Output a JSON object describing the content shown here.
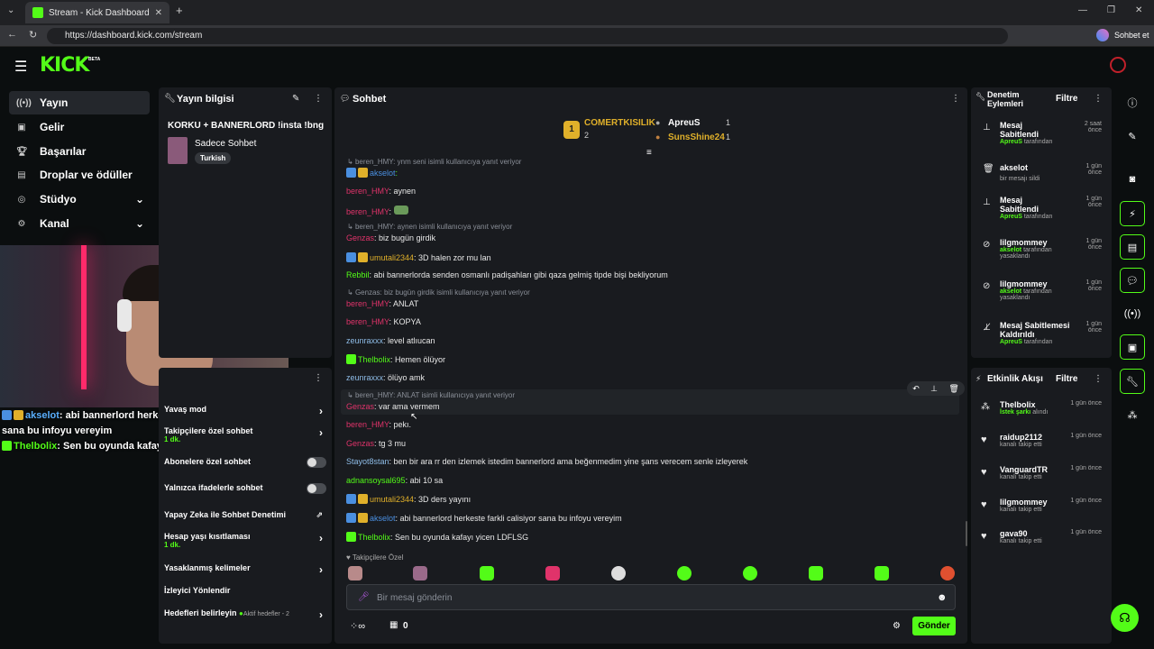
{
  "browser": {
    "tab_title": "Stream - Kick Dashboard",
    "url": "https://dashboard.kick.com/stream",
    "copilot_label": "Sohbet et"
  },
  "app": {
    "logo": "KICK",
    "beta": "BETA"
  },
  "sidebar": {
    "items": [
      {
        "label": "Yayın",
        "icon": "broadcast-icon"
      },
      {
        "label": "Gelir",
        "icon": "revenue-icon"
      },
      {
        "label": "Başarılar",
        "icon": "trophy-icon"
      },
      {
        "label": "Droplar ve ödüller",
        "icon": "gift-icon"
      },
      {
        "label": "Stüdyo",
        "icon": "studio-icon"
      },
      {
        "label": "Kanal",
        "icon": "channel-icon"
      }
    ]
  },
  "stream_info": {
    "header": "Yayın bilgisi",
    "title": "KORKU + BANNERLORD !insta !bng",
    "category": "Sadece Sohbet",
    "tag": "Turkish"
  },
  "overlay_chat": [
    {
      "user": "akselot",
      "text": ": abi bannerlord herkeste farkli calisiyor sana bu infoyu vereyim"
    },
    {
      "user": "Thelbolix",
      "text": ": Sen bu oyunda kafayı yicen LDFLSG"
    }
  ],
  "settings": {
    "rows": [
      {
        "label": "Yavaş mod"
      },
      {
        "label": "Takipçilere özel sohbet",
        "sub": "1 dk."
      },
      {
        "label": "Abonelere özel sohbet"
      },
      {
        "label": "Yalnızca ifadelerle sohbet"
      },
      {
        "label": "Yapay Zeka ile Sohbet Denetimi"
      },
      {
        "label": "Hesap yaşı kısıtlaması",
        "sub": "1 dk."
      },
      {
        "label": "Yasaklanmış kelimeler"
      },
      {
        "label": "İzleyici Yönlendir"
      },
      {
        "label": "Hedefleri belirleyin",
        "sub": "Aktif hedefler - 2"
      }
    ]
  },
  "chat": {
    "header": "Sohbet",
    "top_gifter": {
      "rank": "1",
      "name": "COMERTKISILIK",
      "count": "2"
    },
    "gifters": [
      {
        "name": "ApreuS",
        "count": "1"
      },
      {
        "name": "SunsShine24",
        "count": "1"
      }
    ],
    "messages": [
      {
        "reply": "beren_HMY: ynm seni isimli kullanıcıya yanıt veriyor",
        "user": "akselot",
        "text": "",
        "color": "#4a8fe0"
      },
      {
        "reply": "",
        "user": "beren_HMY",
        "text": ": aynen",
        "color": "#e0336a"
      },
      {
        "reply": "",
        "user": "beren_HMY",
        "text": ":",
        "color": "#e0336a"
      },
      {
        "reply": "beren_HMY: aynen isimli kullanıcıya yanıt veriyor",
        "user": "Genzas",
        "text": ": biz bugün girdik",
        "color": "#e0336a"
      },
      {
        "reply": "",
        "user": "umutali2344",
        "text": ": 3D halen zor mu lan",
        "color": "#e0b02a"
      },
      {
        "reply": "",
        "user": "Rebbil",
        "text": ": abi bannerlorda senden osmanlı padişahları gibi qaza gelmiş tipde bişi bekliyorum",
        "color": "#53fc18"
      },
      {
        "reply": "Genzas: biz bugün girdik isimli kullanıcıya yanıt veriyor",
        "user": "beren_HMY",
        "text": ": ANLAT",
        "color": "#e0336a"
      },
      {
        "reply": "",
        "user": "beren_HMY",
        "text": ": KOPYA",
        "color": "#e0336a"
      },
      {
        "reply": "",
        "user": "zeunraxxx",
        "text": ": level atlıucan",
        "color": "#8fbde8"
      },
      {
        "reply": "",
        "user": "Thelbolix",
        "text": ": Hemen ölüyor",
        "color": "#53fc18"
      },
      {
        "reply": "",
        "user": "zeunraxxx",
        "text": ": ölüyo amk",
        "color": "#8fbde8"
      },
      {
        "reply": "beren_HMY: ANLAT isimli kullanıcıya yanıt veriyor",
        "user": "Genzas",
        "text": ": var ama vermem",
        "color": "#e0336a"
      },
      {
        "reply": "",
        "user": "beren_HMY",
        "text": ": pekı.",
        "color": "#e0336a"
      },
      {
        "reply": "",
        "user": "Genzas",
        "text": ": tg 3 mu",
        "color": "#e0336a"
      },
      {
        "reply": "",
        "user": "Stayot8stan",
        "text": ": ben bir ara rr den izlemek istedim bannerlord ama beğenmedim yine şans verecem senle izleyerek",
        "color": "#8fbde8"
      },
      {
        "reply": "",
        "user": "adnansoysal695",
        "text": ": abi 10 sa",
        "color": "#53fc18"
      },
      {
        "reply": "",
        "user": "umutali2344",
        "text": ": 3D ders yayını",
        "color": "#e0b02a"
      },
      {
        "reply": "",
        "user": "akselot",
        "text": ": abi bannerlord herkeste farkli calisiyor sana bu infoyu vereyim",
        "color": "#4a8fe0"
      },
      {
        "reply": "",
        "user": "Thelbolix",
        "text": ": Sen bu oyunda kafayı yicen LDFLSG",
        "color": "#53fc18"
      }
    ],
    "emote_section": "Takipçilere Özel",
    "input_placeholder": "Bir mesaj gönderin",
    "points": "0",
    "send_label": "Gönder"
  },
  "mod_actions": {
    "header": "Denetim Eylemleri",
    "filter": "Filtre",
    "items": [
      {
        "title": "Mesaj Sabitlendi",
        "by": "ApreuS",
        "suffix": "tarafından",
        "time": "2 saat önce",
        "icon": "pin-icon"
      },
      {
        "title": "akselot",
        "by": "",
        "suffix": "bir mesajı sildi",
        "time": "1 gün önce",
        "icon": "trash-icon"
      },
      {
        "title": "Mesaj Sabitlendi",
        "by": "ApreuS",
        "suffix": "tarafından",
        "time": "1 gün önce",
        "icon": "pin-icon"
      },
      {
        "title": "lilgmommey",
        "by": "akselot",
        "suffix": "tarafından yasaklandı",
        "time": "1 gün önce",
        "icon": "ban-icon"
      },
      {
        "title": "lilgmommey",
        "by": "akselot",
        "suffix": "tarafından yasaklandı",
        "time": "1 gün önce",
        "icon": "ban-icon"
      },
      {
        "title": "Mesaj Sabitlemesi Kaldırıldı",
        "by": "ApreuS",
        "suffix": "tarafından",
        "time": "1 gün önce",
        "icon": "unpin-icon"
      }
    ]
  },
  "events": {
    "header": "Etkinlik Akışı",
    "filter": "Filtre",
    "items": [
      {
        "title": "Thelbolix",
        "by": "İstek şarkı",
        "suffix": "alındı",
        "time": "1 gün önce"
      },
      {
        "title": "raidup2112",
        "by": "",
        "suffix": "kanalı takip etti",
        "time": "1 gün önce"
      },
      {
        "title": "VanguardTR",
        "by": "",
        "suffix": "kanalı takip etti",
        "time": "1 gün önce"
      },
      {
        "title": "lilgmommey",
        "by": "",
        "suffix": "kanalı takip etti",
        "time": "1 gün önce"
      },
      {
        "title": "gava90",
        "by": "",
        "suffix": "kanalı takip etti",
        "time": "1 gün önce"
      }
    ]
  },
  "colors": {
    "accent": "#53fc18",
    "panel": "#191b1f",
    "bg": "#0b0e0f"
  }
}
